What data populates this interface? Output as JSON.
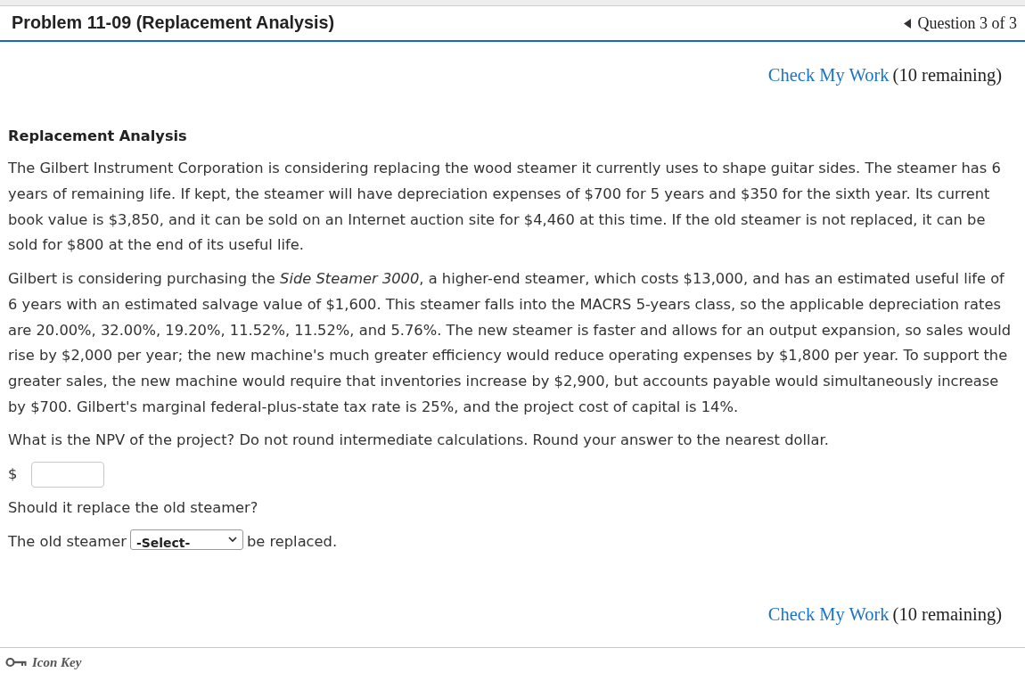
{
  "header": {
    "title": "Problem 11-09 (Replacement Analysis)",
    "question_nav": "Question 3 of 3"
  },
  "check_top": {
    "link": "Check My Work",
    "remaining": "(10 remaining)"
  },
  "problem": {
    "heading": "Replacement Analysis",
    "paragraphs": [
      "The Gilbert Instrument Corporation is considering replacing the wood steamer it currently uses to shape guitar sides. The steamer has 6 years of remaining life. If kept, the steamer will have depreciation expenses of $700 for 5 years and $350 for the sixth year. Its current book value is $3,850, and it can be sold on an Internet auction site for $4,460 at this time. If the old steamer is not replaced, it can be sold for $800 at the end of its useful life.",
      "Gilbert is considering purchasing the *Side Steamer 3000*, a higher-end steamer, which costs $13,000, and has an estimated useful life of 6 years with an estimated salvage value of $1,600. This steamer falls into the MACRS 5-years class, so the applicable depreciation rates are 20.00%, 32.00%, 19.20%, 11.52%, 11.52%, and 5.76%. The new steamer is faster and allows for an output expansion, so sales would rise by $2,000 per year; the new machine's much greater efficiency would reduce operating expenses by $1,800 per year. To support the greater sales, the new machine would require that inventories increase by $2,900, but accounts payable would simultaneously increase by $700. Gilbert's marginal federal-plus-state tax rate is 25%, and the project cost of capital is 14%."
    ],
    "question": "What is the NPV of the project? Do not round intermediate calculations. Round your answer to the nearest dollar.",
    "answer": {
      "prefix": "$"
    },
    "question_2": "Should it replace the old steamer?",
    "choice": {
      "before": "The old steamer",
      "select": "-Select-",
      "after": "be replaced."
    }
  },
  "check_bottom": {
    "link": "Check My Work",
    "remaining": "(10 remaining)"
  },
  "footer": {
    "icon_key": "Icon Key"
  }
}
